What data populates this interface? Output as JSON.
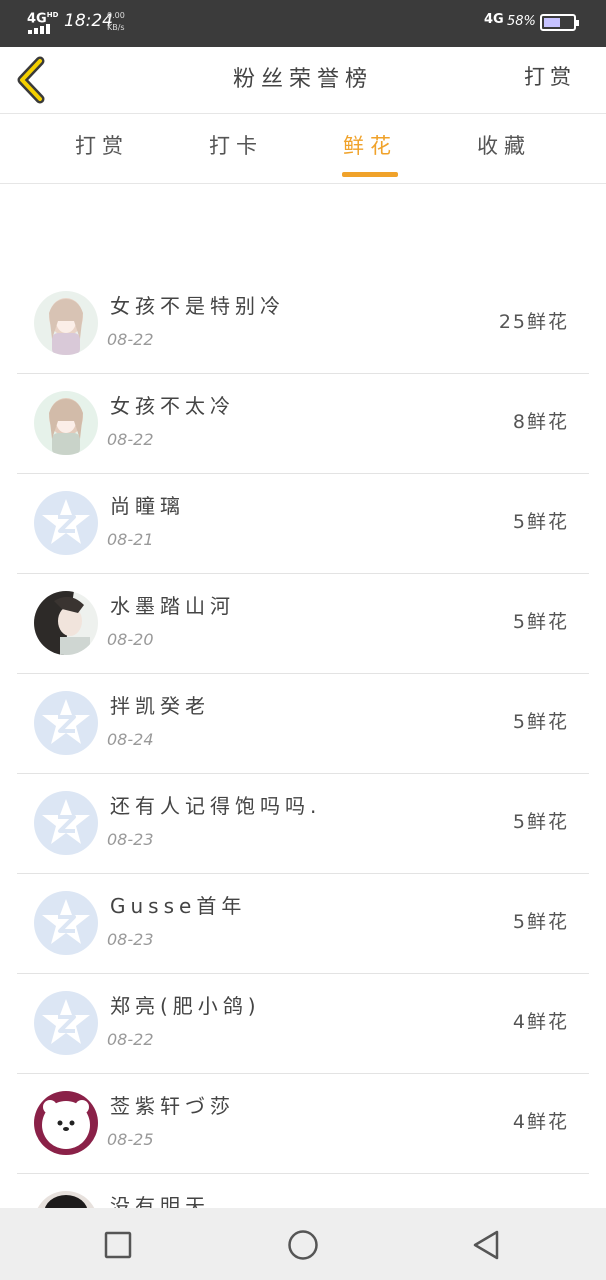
{
  "status_bar": {
    "network_left": "4G",
    "network_left_sup": "HD",
    "time": "18:24",
    "speed_value": "0.00",
    "speed_unit": "KB/s",
    "network_right": "4G",
    "battery_percent": "58%",
    "battery_level": 0.58
  },
  "header": {
    "back_icon": "chevron-left-icon",
    "title": "粉丝荣誉榜",
    "action_label": "打赏"
  },
  "tabs": [
    {
      "label": "打赏",
      "active": false
    },
    {
      "label": "打卡",
      "active": false
    },
    {
      "label": "鲜花",
      "active": true
    },
    {
      "label": "收藏",
      "active": false
    }
  ],
  "colors": {
    "accent": "#f0a22a",
    "status_bar_bg": "#3b3b3b",
    "default_avatar_bg": "#dce6f4",
    "default_avatar_fg": "#ffffff"
  },
  "fans": [
    {
      "name": "女孩不是特别冷",
      "date": "08-22",
      "count": "25鲜花",
      "avatar": "anime-girl-1"
    },
    {
      "name": "女孩不太冷",
      "date": "08-22",
      "count": "8鲜花",
      "avatar": "anime-girl-2"
    },
    {
      "name": "尚瞳璃",
      "date": "08-21",
      "count": "5鲜花",
      "avatar": "default-z"
    },
    {
      "name": "水墨踏山河",
      "date": "08-20",
      "count": "5鲜花",
      "avatar": "anime-swordsman"
    },
    {
      "name": "拌凯癸老",
      "date": "08-24",
      "count": "5鲜花",
      "avatar": "default-z"
    },
    {
      "name": "还有人记得饱吗吗.",
      "date": "08-23",
      "count": "5鲜花",
      "avatar": "default-z"
    },
    {
      "name": "Gusse首年",
      "date": "08-23",
      "count": "5鲜花",
      "avatar": "default-z"
    },
    {
      "name": "郑亮(肥小鸽)",
      "date": "08-22",
      "count": "4鲜花",
      "avatar": "default-z"
    },
    {
      "name": "莶紫轩づ莎",
      "date": "08-25",
      "count": "4鲜花",
      "avatar": "white-bear"
    },
    {
      "name": "没有明天",
      "date": "",
      "count": "",
      "avatar": "dark-hair"
    }
  ],
  "nav_bar": {
    "recent_icon": "square-icon",
    "home_icon": "circle-icon",
    "back_icon": "triangle-back-icon"
  }
}
